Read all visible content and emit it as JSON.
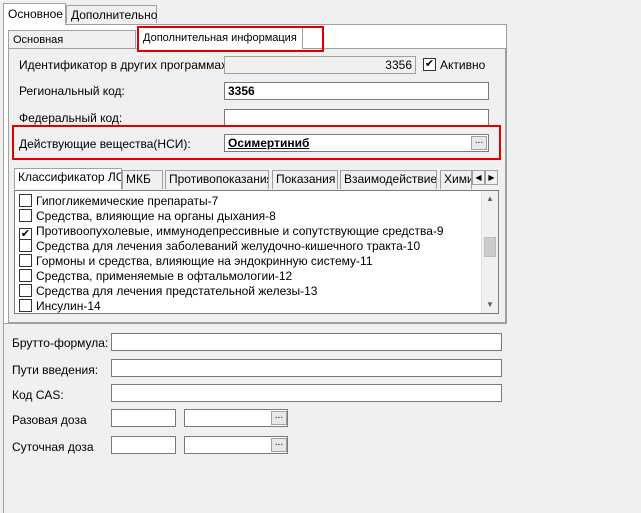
{
  "top_tabs": [
    "Основное",
    "Дополнительно"
  ],
  "sub_tabs": [
    "Основная информация",
    "Дополнительная информация"
  ],
  "form": {
    "ext_id_label": "Идентификатор в других программах:",
    "ext_id_value": "3356",
    "active_label": "Активно",
    "active_checked": true,
    "regional_label": "Региональный код:",
    "regional_value": "3356",
    "federal_label": "Федеральный код:",
    "federal_value": "",
    "substances_label": "Действующие вещества(НСИ):",
    "substances_value": "Осимертиниб",
    "ellipsis": "..."
  },
  "inner_tabs": [
    "Классификатор ЛС",
    "МКБ",
    "Противопоказания",
    "Показания",
    "Взаимодействие",
    "Хими"
  ],
  "classifier_items": [
    {
      "label": "Гипогликемические препараты-7",
      "checked": false
    },
    {
      "label": "Средства, влияющие на органы дыхания-8",
      "checked": false
    },
    {
      "label": "Противоопухолевые, иммунодепрессивные и сопутствующие средства-9",
      "checked": true
    },
    {
      "label": "Средства для лечения заболеваний желудочно-кишечного тракта-10",
      "checked": false
    },
    {
      "label": "Гормоны и средства, влияющие на эндокринную систему-11",
      "checked": false
    },
    {
      "label": "Средства, применяемые в офтальмологии-12",
      "checked": false
    },
    {
      "label": "Средства для лечения предстательной железы-13",
      "checked": false
    },
    {
      "label": "Инсулин-14",
      "checked": false
    }
  ],
  "lower": {
    "formula_label": "Брутто-формула:",
    "routes_label": "Пути введения:",
    "cas_label": "Код CAS:",
    "single_dose_label": "Разовая доза",
    "daily_dose_label": "Суточная доза",
    "ellipsis": "..."
  }
}
